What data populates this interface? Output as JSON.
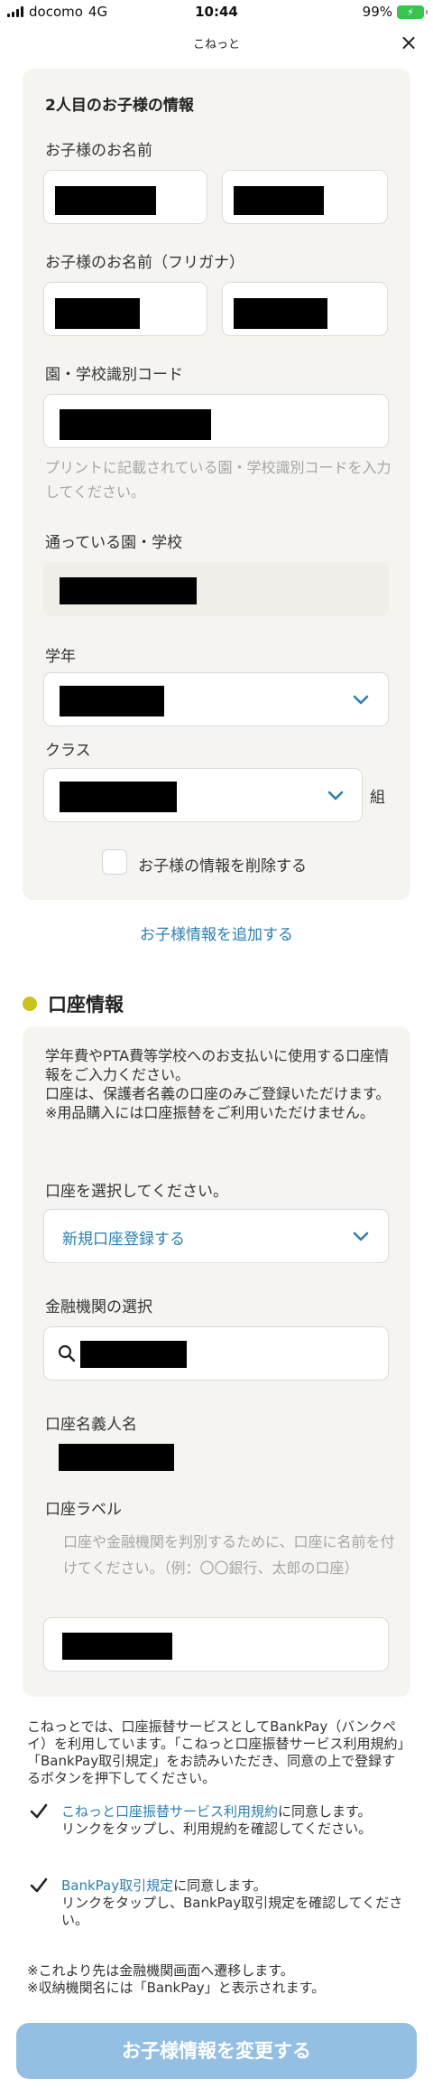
{
  "status_bar": {
    "carrier": "docomo",
    "network": "4G",
    "time": "10:44",
    "battery": "99%"
  },
  "nav": {
    "title": "こねっと",
    "close": "×"
  },
  "child": {
    "title": "2人目のお子様の情報",
    "name_label": "お子様のお名前",
    "kana_label": "お子様のお名前（フリガナ）",
    "code_label": "園・学校識別コード",
    "code_help": "プリントに記載されている園・学校識別コードを入力してください。",
    "school_label": "通っている園・学校",
    "grade_label": "学年",
    "class_label": "クラス",
    "class_suffix": "組",
    "delete_label": "お子様の情報を削除する"
  },
  "add_child_link": "お子様情報を追加する",
  "account": {
    "section_title": "口座情報",
    "intro": [
      "学年費やPTA費等学校へのお支払いに使用する口座情報をご入力ください。",
      "口座は、保護者名義の口座のみご登録いただけます。",
      "※用品購入には口座振替をご利用いただけません。"
    ],
    "select_label": "口座を選択してください。",
    "select_value": "新規口座登録する",
    "bank_label": "金融機関の選択",
    "holder_label": "口座名義人名",
    "account_label_label": "口座ラベル",
    "account_label_help": "口座や金融機関を判別するために、口座に名前を付けてください。（例：〇〇銀行、太郎の口座）"
  },
  "terms": {
    "intro": "こねっとでは、口座振替サービスとしてBankPay（バンクペイ）を利用しています。「こねっと口座振替サービス利用規約」「BankPay取引規定」をお読みいただき、同意の上で登録するボタンを押下してください。",
    "agree1_link": "こねっと口座振替サービス利用規約",
    "agree1_rest": "に同意します。",
    "agree1_sub": "リンクをタップし、利用規約を確認してください。",
    "agree2_link": "BankPay取引規定",
    "agree2_rest": "に同意します。",
    "agree2_sub": "リンクをタップし、BankPay取引規定を確認してください。",
    "note1": "※これより先は金融機関画面へ遷移します。",
    "note2": "※収納機関名には「BankPay」と表示されます。"
  },
  "submit_label": "お子様情報を変更する",
  "colors": {
    "link": "#2c7fb0",
    "accent_dot": "#c8c21a",
    "submit_bg": "#93bfe3",
    "card_bg": "#f5f4f0"
  }
}
